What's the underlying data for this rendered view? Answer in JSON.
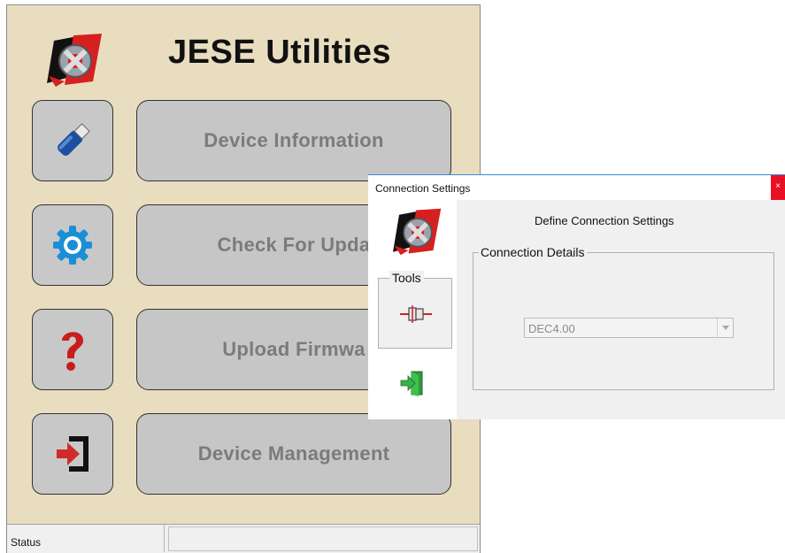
{
  "main_window": {
    "title": "JESE Utilities",
    "buttons": [
      {
        "label": "Device Information",
        "icon": "usb-stick-icon"
      },
      {
        "label": "Check For Upda",
        "icon": "gear-icon"
      },
      {
        "label": "Upload Firmwa",
        "icon": "help-question-icon"
      },
      {
        "label": "Device Management",
        "icon": "exit-door-icon"
      }
    ],
    "status_label": "Status"
  },
  "dialog": {
    "title": "Connection Settings",
    "close_label": "×",
    "heading": "Define Connection Settings",
    "tools_label": "Tools",
    "details_label": "Connection Details",
    "combo_value": "DEC4.00"
  },
  "colors": {
    "main_bg": "#e9ddc0",
    "button_bg": "#c6c6c6",
    "button_text": "#7b7b7b",
    "dialog_border": "#3c8ad8",
    "close_red": "#e81123"
  }
}
